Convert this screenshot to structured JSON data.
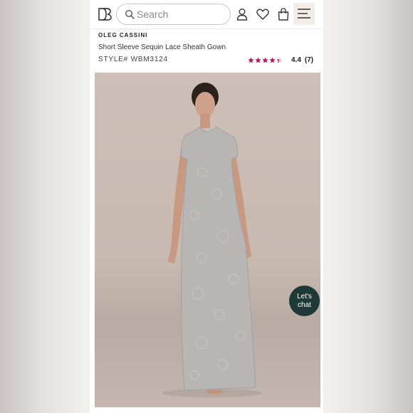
{
  "header": {
    "logo_icon": "db-logo-icon",
    "search": {
      "placeholder": "Search",
      "icon": "search-icon"
    },
    "icons": [
      "account-icon",
      "heart-icon",
      "bag-icon",
      "menu-icon"
    ]
  },
  "product": {
    "brand": "OLEG CASSINI",
    "name": "Short Sleeve Sequin Lace Sheath Gown",
    "style": "STYLE# WBM3124",
    "rating": {
      "stars": 4.4,
      "max_stars": 5,
      "score": "4.4",
      "count": "(7)",
      "star_color": "#b5155a"
    }
  },
  "image": {
    "alt": "Model wearing silver sequin lace sheath gown"
  },
  "chat": {
    "line1": "Let's",
    "line2": "chat",
    "background": "#1f3a36"
  }
}
